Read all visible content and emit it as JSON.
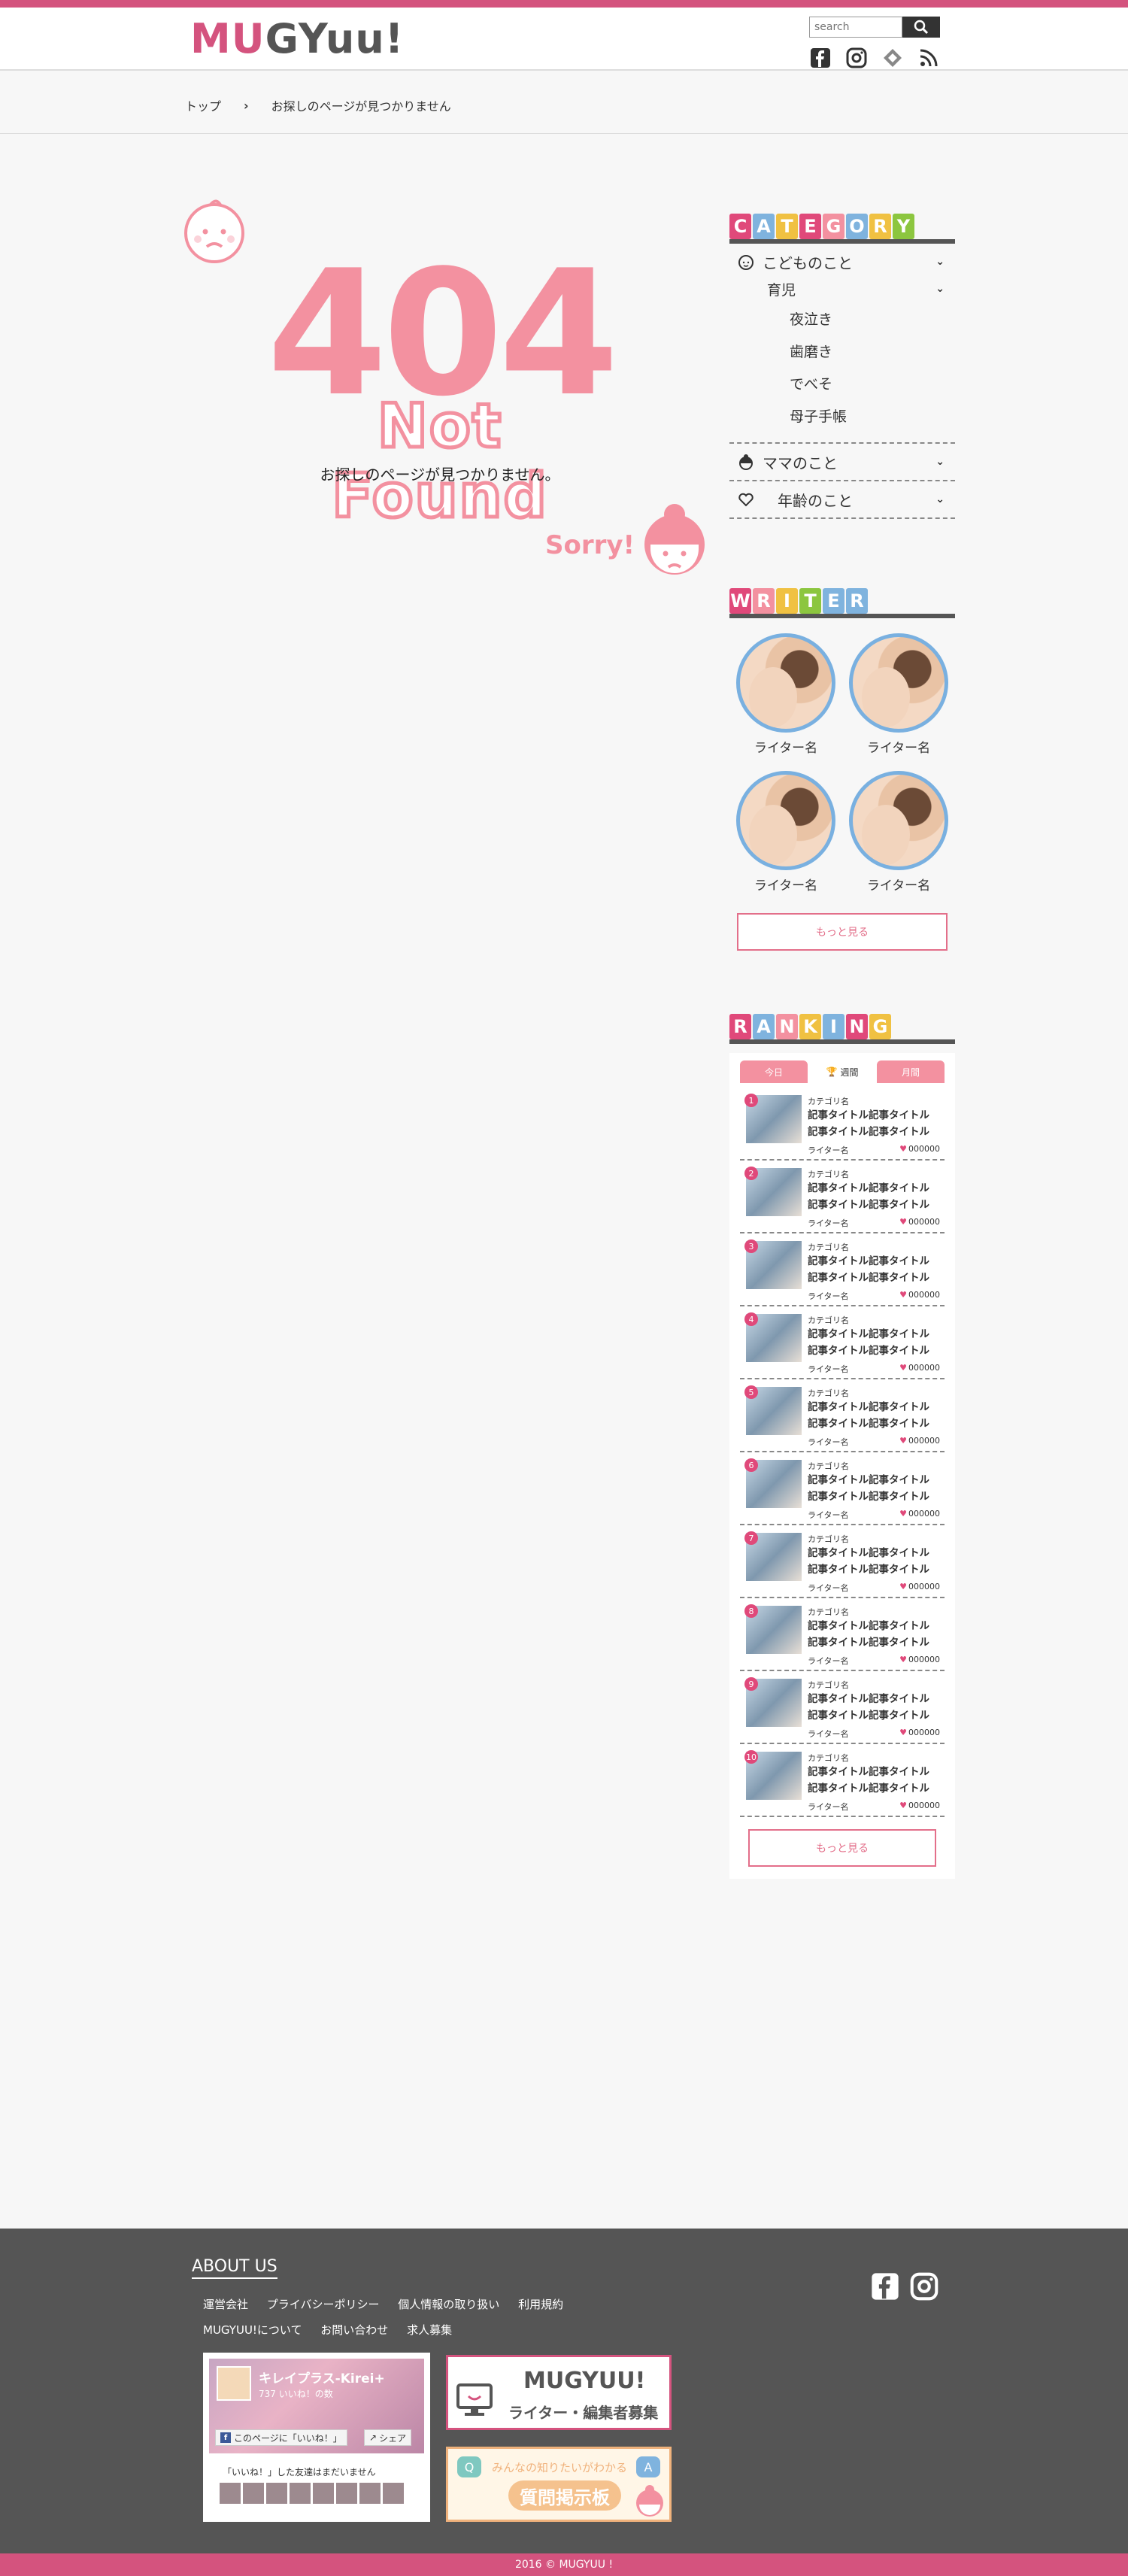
{
  "site": {
    "logo_text": "MUGYUU!"
  },
  "colors": {
    "accent": "#d4537e",
    "pink": "#f391a0",
    "footer_bg": "#555555"
  },
  "search": {
    "placeholder": "search",
    "icon": "search-icon"
  },
  "header_social": [
    "facebook-icon",
    "instagram-icon",
    "feedly-icon",
    "rss-icon"
  ],
  "breadcrumb": {
    "home": "トップ",
    "current": "お探しのページが見つかりません"
  },
  "error": {
    "code": "404",
    "title": "Not Found",
    "message": "お探しのページが見つかりません。",
    "sorry": "Sorry!"
  },
  "sidebar": {
    "category": {
      "heading_letters": [
        "C",
        "A",
        "T",
        "E",
        "G",
        "O",
        "R",
        "Y"
      ],
      "items": [
        {
          "label": "こどものこと",
          "icon": "baby-face-icon"
        },
        {
          "label": "ママのこと",
          "icon": "mom-icon"
        },
        {
          "label": "年齢のこと",
          "icon": "heart-icon"
        }
      ],
      "sub": {
        "label": "育児"
      },
      "subsub": [
        "夜泣き",
        "歯磨き",
        "でべそ",
        "母子手帳"
      ]
    },
    "writer": {
      "heading_letters": [
        "W",
        "R",
        "I",
        "T",
        "E",
        "R"
      ],
      "names": [
        "ライター名",
        "ライター名",
        "ライター名",
        "ライター名"
      ],
      "more": "もっと見る"
    },
    "ranking": {
      "heading_letters": [
        "R",
        "A",
        "N",
        "K",
        "I",
        "N",
        "G"
      ],
      "tabs": [
        "今日",
        "週間",
        "月間"
      ],
      "items": [
        {
          "rank": "1",
          "category": "カテゴリ名",
          "title": "記事タイトル記事タイトル記事タイトル記事タイトル記事",
          "writer": "ライター名",
          "count": "000000"
        },
        {
          "rank": "2",
          "category": "カテゴリ名",
          "title": "記事タイトル記事タイトル記事タイトル記事タイトル記事",
          "writer": "ライター名",
          "count": "000000"
        },
        {
          "rank": "3",
          "category": "カテゴリ名",
          "title": "記事タイトル記事タイトル記事タイトル記事タイトル記事",
          "writer": "ライター名",
          "count": "000000"
        },
        {
          "rank": "4",
          "category": "カテゴリ名",
          "title": "記事タイトル記事タイトル記事タイトル記事タイトル記事",
          "writer": "ライター名",
          "count": "000000"
        },
        {
          "rank": "5",
          "category": "カテゴリ名",
          "title": "記事タイトル記事タイトル記事タイトル記事タイトル記事",
          "writer": "ライター名",
          "count": "000000"
        },
        {
          "rank": "6",
          "category": "カテゴリ名",
          "title": "記事タイトル記事タイトル記事タイトル記事タイトル記事",
          "writer": "ライター名",
          "count": "000000"
        },
        {
          "rank": "7",
          "category": "カテゴリ名",
          "title": "記事タイトル記事タイトル記事タイトル記事タイトル記事",
          "writer": "ライター名",
          "count": "000000"
        },
        {
          "rank": "8",
          "category": "カテゴリ名",
          "title": "記事タイトル記事タイトル記事タイトル記事タイトル記事",
          "writer": "ライター名",
          "count": "000000"
        },
        {
          "rank": "9",
          "category": "カテゴリ名",
          "title": "記事タイトル記事タイトル記事タイトル記事タイトル記事",
          "writer": "ライター名",
          "count": "000000"
        },
        {
          "rank": "10",
          "category": "カテゴリ名",
          "title": "記事タイトル記事タイトル記事タイトル記事タイトル記事",
          "writer": "ライター名",
          "count": "000000"
        }
      ],
      "more": "もっと見る"
    }
  },
  "footer": {
    "about_title": "ABOUT US",
    "links": [
      "運営会社",
      "プライバシーポリシー",
      "個人情報の取り扱い",
      "利用規約",
      "MUGYUU!について",
      "お問い合わせ",
      "求人募集"
    ],
    "fb": {
      "page_name": "キレイプラス-Kirei+",
      "likes": "737 いいね！の数",
      "like_btn": "このページに「いいね！」",
      "share_btn": "シェア",
      "friends_msg": "「いいね！」した友達はまだいません"
    },
    "banner_recruit": {
      "logo": "MUGYUU!",
      "text": "ライター・編集者募集"
    },
    "banner_qa": {
      "sub": "みんなの知りたいがわかる",
      "text": "質問掲示板"
    },
    "copyright": "2016 © MUGYUU !"
  }
}
